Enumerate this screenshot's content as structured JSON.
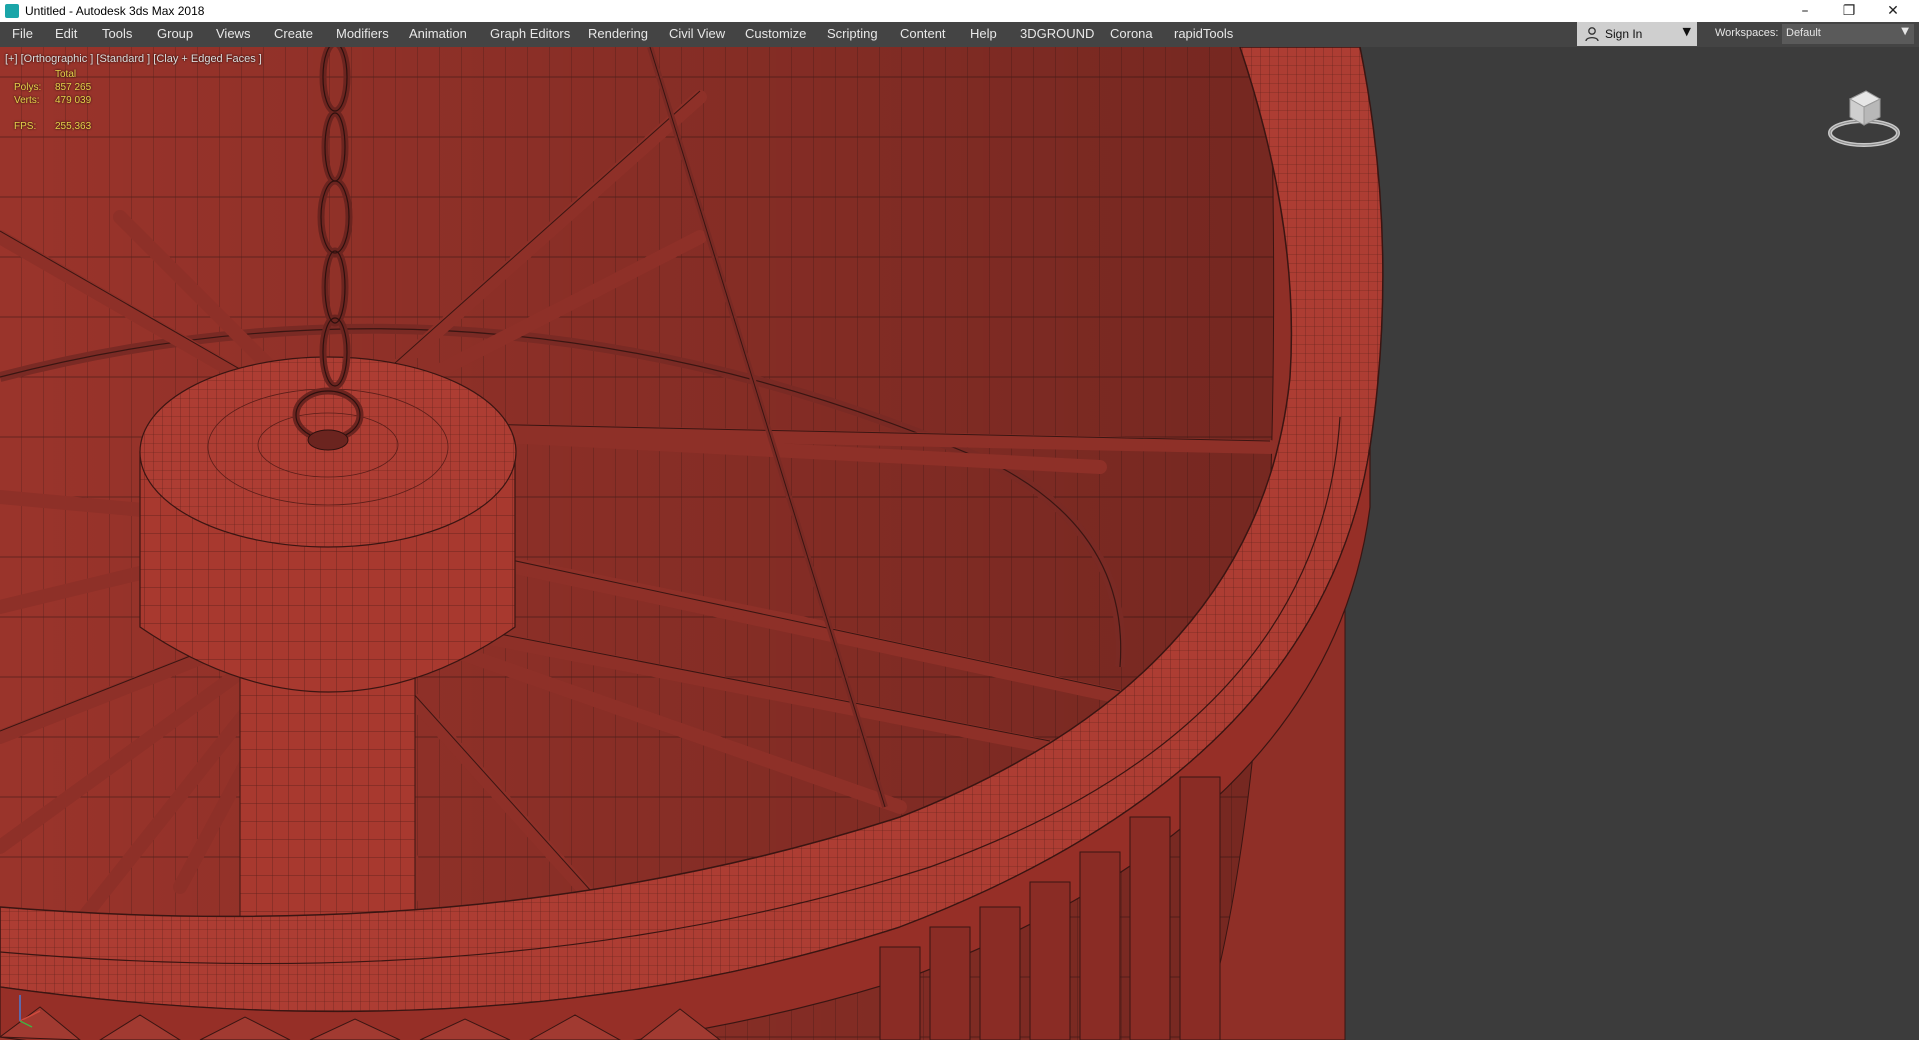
{
  "window": {
    "title": "Untitled - Autodesk 3ds Max 2018",
    "minimize_icon": "minimize-icon",
    "restore_icon": "restore-icon",
    "close_icon": "close-icon"
  },
  "menubar": {
    "items": [
      "File",
      "Edit",
      "Tools",
      "Group",
      "Views",
      "Create",
      "Modifiers",
      "Animation",
      "Graph Editors",
      "Rendering",
      "Civil View",
      "Customize",
      "Scripting",
      "Content",
      "Help",
      "3DGROUND",
      "Corona",
      "rapidTools"
    ]
  },
  "account": {
    "signin_label": "Sign In",
    "icon": "user-icon"
  },
  "workspaces": {
    "label": "Workspaces:",
    "value": "Default"
  },
  "viewport": {
    "label": "[+] [Orthographic ] [Standard ] [Clay + Edged Faces ]",
    "stats": {
      "header": "Total",
      "polys_label": "Polys:",
      "polys_value": "857 265",
      "verts_label": "Verts:",
      "verts_value": "479 039",
      "fps_label": "FPS:",
      "fps_value": "255,363"
    }
  },
  "colors": {
    "clay": "#a8392f",
    "clay_dark": "#7a2a24",
    "wire": "#3a1512",
    "viewport_bg": "#3c3c3c",
    "stats_text": "#e5d24a"
  }
}
